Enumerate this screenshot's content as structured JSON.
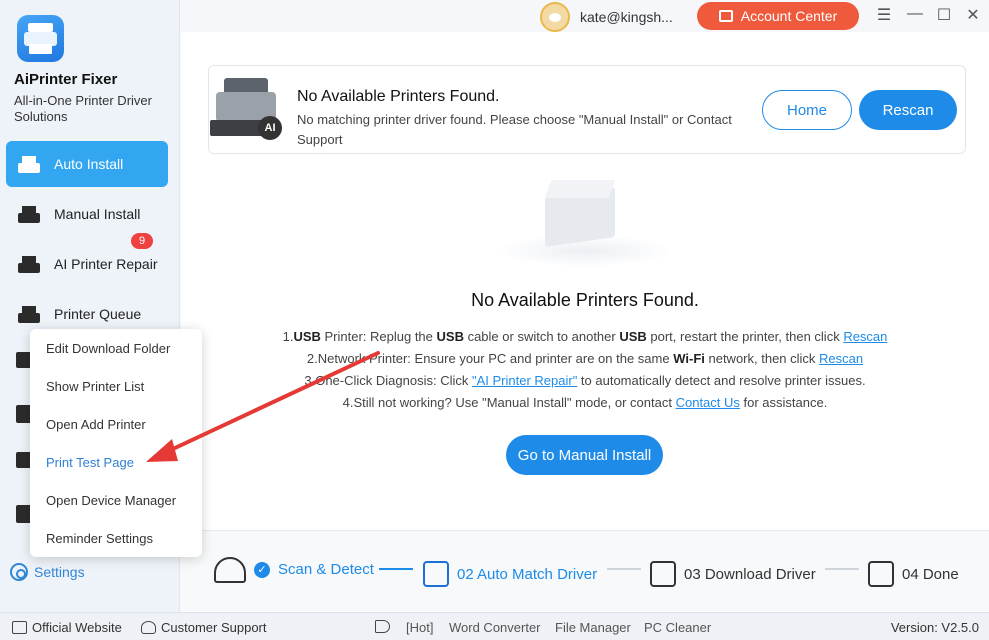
{
  "app": {
    "name": "AiPrinter Fixer",
    "subtitle": "All-in-One Printer Driver Solutions"
  },
  "sidebar": {
    "items": [
      {
        "label": "Auto Install",
        "active": true
      },
      {
        "label": "Manual Install"
      },
      {
        "label": "AI Printer Repair",
        "badge": "9"
      },
      {
        "label": "Printer Queue"
      }
    ],
    "settings_label": "Settings"
  },
  "context_menu": {
    "items": [
      "Edit Download Folder",
      "Show Printer List",
      "Open Add Printer",
      "Print Test Page",
      "Open Device Manager",
      "Reminder Settings"
    ],
    "highlighted": "Print Test Page"
  },
  "topbar": {
    "user_email": "kate@kingsh...",
    "account_button": "Account Center",
    "window_controls": [
      "menu-icon",
      "minimize-icon",
      "maximize-icon",
      "close-icon"
    ]
  },
  "banner": {
    "title": "No Available Printers Found.",
    "description": "No matching printer driver found. Please choose \"Manual Install\" or Contact Support",
    "home_button": "Home",
    "rescan_button": "Rescan"
  },
  "empty_state": {
    "title": "No Available Printers Found.",
    "lines": [
      {
        "parts": [
          {
            "t": "1."
          },
          {
            "t": "USB",
            "b": true
          },
          {
            "t": " Printer: Replug the "
          },
          {
            "t": "USB",
            "b": true
          },
          {
            "t": " cable or switch to another "
          },
          {
            "t": "USB",
            "b": true
          },
          {
            "t": " port, restart the printer, then click "
          },
          {
            "t": "Rescan",
            "link": true
          }
        ]
      },
      {
        "parts": [
          {
            "t": "2.Network Printer: Ensure your PC and printer are on the same "
          },
          {
            "t": "Wi-Fi",
            "b": true
          },
          {
            "t": " network, then click "
          },
          {
            "t": "Rescan",
            "link": true
          }
        ]
      },
      {
        "parts": [
          {
            "t": "3.One-Click Diagnosis: Click "
          },
          {
            "t": "\"AI Printer Repair\"",
            "link": true
          },
          {
            "t": " to automatically detect and resolve printer issues."
          }
        ]
      },
      {
        "parts": [
          {
            "t": "4.Still not working? Use \"Manual Install\" mode, or contact "
          },
          {
            "t": "Contact Us",
            "link": true
          },
          {
            "t": " for assistance."
          }
        ]
      }
    ],
    "manual_button": "Go to Manual Install"
  },
  "progress_steps": [
    {
      "label": "Scan & Detect",
      "state": "done"
    },
    {
      "label": "02 Auto Match Driver",
      "state": "active"
    },
    {
      "label": "03 Download Driver",
      "state": "todo"
    },
    {
      "label": "04 Done",
      "state": "todo"
    }
  ],
  "footer": {
    "official_website": "Official Website",
    "customer_support": "Customer Support",
    "hot_tag": "[Hot]",
    "word_converter": "Word Converter",
    "file_manager": "File Manager",
    "pc_cleaner": "PC Cleaner",
    "version": "Version: V2.5.0"
  },
  "colors": {
    "accent": "#1e8be8",
    "sidebar_active": "#32a6f0",
    "account_button": "#f05a3c",
    "badge": "#f04141",
    "annotation_arrow": "#e53935"
  }
}
